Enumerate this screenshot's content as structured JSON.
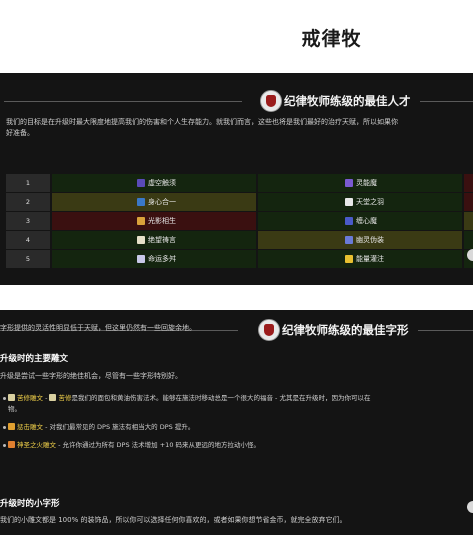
{
  "page_title": "戒律牧",
  "section1": {
    "heading": "纪律牧师练级的最佳人才",
    "intro_line1": "我们的目标是在升级时最大限度地提高我们的伤害和个人生存能力。就我们而言，这些也将是我们最好的治疗天赋，所以如果你",
    "intro_line2": "好准备。",
    "rows": [
      {
        "num": "1",
        "a": "虚空触须",
        "b": "灵能魔"
      },
      {
        "num": "2",
        "a": "身心合一",
        "b": "天堂之羽"
      },
      {
        "num": "3",
        "a": "光影相生",
        "b": "缠心魔"
      },
      {
        "num": "4",
        "a": "绝望祷言",
        "b": "幽灵伪装"
      },
      {
        "num": "5",
        "a": "命运多舛",
        "b": "能量灌注"
      }
    ]
  },
  "section2": {
    "heading": "纪律牧师练级的最佳字形",
    "intro": "字形提供的灵活性明显低于天赋，但这里仍然有一些回旋余地。",
    "major_heading": "升级时的主要雕文",
    "major_intro": "升级是尝试一些字形的绝佳机会，尽管有一些字形特别好。",
    "bullets": [
      {
        "name": "苦修雕文",
        "sep": " - ",
        "name2": "苦修",
        "text": "是我们的面包和黄油伤害法术。能够在施法时移动总是一个很大的福音 - 尤其是在升级时，因为你可以在",
        "text2": "物。"
      },
      {
        "name": "惩击雕文",
        "sep": " - ",
        "text": "对我们最常见的 DPS 施法有相当大的 DPS 提升。"
      },
      {
        "name": "神圣之火雕文",
        "sep": " - ",
        "text": "允许你通过为所有 DPS 法术增加 +10 码来从更远的地方拉动小怪。"
      }
    ],
    "minor_heading": "升级时的小字形",
    "minor_text": "我们的小雕文都是 100% 的装饰品，所以你可以选择任何你喜欢的，或者如果你想节省金币，就完全放弃它们。"
  },
  "colors": {
    "row_green": "#14250f",
    "row_olive": "#3a3a14",
    "row_red": "#3a1010",
    "highlight": "#f3d24a"
  }
}
